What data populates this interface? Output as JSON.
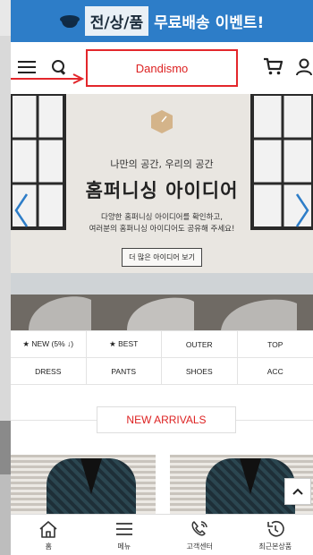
{
  "promo": {
    "highlight": "전/상/품",
    "text": "무료배송 이벤트!"
  },
  "header": {
    "logo": "Dandismo"
  },
  "hero": {
    "subtitle": "나만의 공간, 우리의 공간",
    "title": "홈퍼니싱 아이디어",
    "desc_line1": "다양한 홈퍼니싱 아이디어를 확인하고,",
    "desc_line2": "여러분의 홈퍼니싱 아이디어도 공유해 주세요!",
    "button": "더 많은 아이디어 보기"
  },
  "categories": [
    "★ NEW (5% ↓)",
    "★ BEST",
    "OUTER",
    "TOP",
    "DRESS",
    "PANTS",
    "SHOES",
    "ACC"
  ],
  "section": {
    "title": "NEW ARRIVALS"
  },
  "bottom_nav": [
    {
      "label": "홈",
      "icon": "home-icon"
    },
    {
      "label": "메뉴",
      "icon": "menu-icon"
    },
    {
      "label": "고객센터",
      "icon": "phone-icon"
    },
    {
      "label": "최근본상품",
      "icon": "history-icon"
    }
  ],
  "colors": {
    "promo_bg": "#2d7dc8",
    "accent_red": "#e3262b"
  }
}
